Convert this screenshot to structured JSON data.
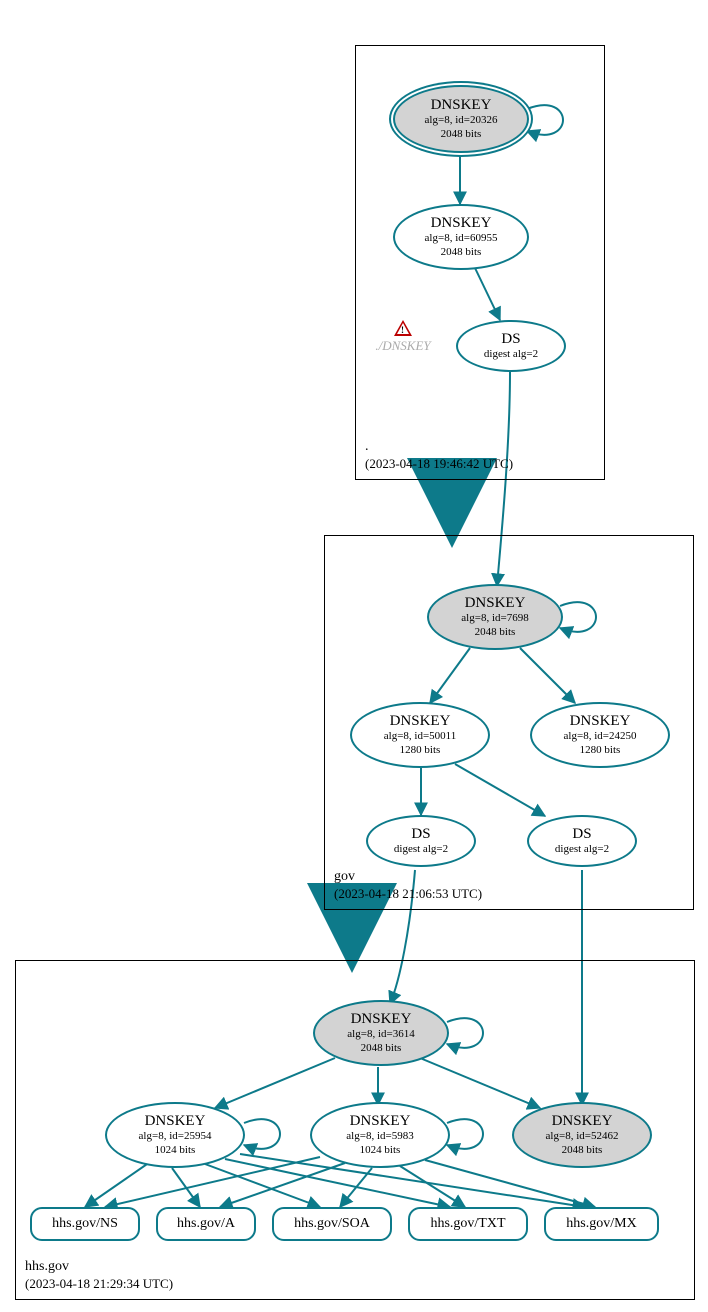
{
  "zones": {
    "root": {
      "name": ".",
      "timestamp": "(2023-04-18 19:46:42 UTC)"
    },
    "gov": {
      "name": "gov",
      "timestamp": "(2023-04-18 21:06:53 UTC)"
    },
    "hhs": {
      "name": "hhs.gov",
      "timestamp": "(2023-04-18 21:29:34 UTC)"
    }
  },
  "nodes": {
    "root_ksk": {
      "title": "DNSKEY",
      "line2": "alg=8, id=20326",
      "line3": "2048 bits"
    },
    "root_zsk": {
      "title": "DNSKEY",
      "line2": "alg=8, id=60955",
      "line3": "2048 bits"
    },
    "root_ds": {
      "title": "DS",
      "line2": "digest alg=2"
    },
    "root_warn": {
      "label": "./DNSKEY"
    },
    "gov_ksk": {
      "title": "DNSKEY",
      "line2": "alg=8, id=7698",
      "line3": "2048 bits"
    },
    "gov_zsk1": {
      "title": "DNSKEY",
      "line2": "alg=8, id=50011",
      "line3": "1280 bits"
    },
    "gov_zsk2": {
      "title": "DNSKEY",
      "line2": "alg=8, id=24250",
      "line3": "1280 bits"
    },
    "gov_ds1": {
      "title": "DS",
      "line2": "digest alg=2"
    },
    "gov_ds2": {
      "title": "DS",
      "line2": "digest alg=2"
    },
    "hhs_ksk": {
      "title": "DNSKEY",
      "line2": "alg=8, id=3614",
      "line3": "2048 bits"
    },
    "hhs_zsk1": {
      "title": "DNSKEY",
      "line2": "alg=8, id=25954",
      "line3": "1024 bits"
    },
    "hhs_zsk2": {
      "title": "DNSKEY",
      "line2": "alg=8, id=5983",
      "line3": "1024 bits"
    },
    "hhs_other": {
      "title": "DNSKEY",
      "line2": "alg=8, id=52462",
      "line3": "2048 bits"
    },
    "rr_ns": {
      "label": "hhs.gov/NS"
    },
    "rr_a": {
      "label": "hhs.gov/A"
    },
    "rr_soa": {
      "label": "hhs.gov/SOA"
    },
    "rr_txt": {
      "label": "hhs.gov/TXT"
    },
    "rr_mx": {
      "label": "hhs.gov/MX"
    }
  },
  "chart_data": {
    "type": "diagram",
    "description": "DNSSEC authentication chain / DNSViz-style graph",
    "zones": [
      {
        "name": ".",
        "timestamp": "2023-04-18 19:46:42 UTC"
      },
      {
        "name": "gov",
        "timestamp": "2023-04-18 21:06:53 UTC"
      },
      {
        "name": "hhs.gov",
        "timestamp": "2023-04-18 21:29:34 UTC"
      }
    ],
    "nodes": [
      {
        "id": "root_ksk",
        "zone": ".",
        "type": "DNSKEY",
        "alg": 8,
        "key_id": 20326,
        "bits": 2048,
        "ksk": true,
        "trust_anchor": true
      },
      {
        "id": "root_zsk",
        "zone": ".",
        "type": "DNSKEY",
        "alg": 8,
        "key_id": 60955,
        "bits": 2048
      },
      {
        "id": "root_ds",
        "zone": ".",
        "type": "DS",
        "digest_alg": 2
      },
      {
        "id": "root_warn",
        "zone": ".",
        "type": "warning",
        "label": "./DNSKEY"
      },
      {
        "id": "gov_ksk",
        "zone": "gov",
        "type": "DNSKEY",
        "alg": 8,
        "key_id": 7698,
        "bits": 2048,
        "ksk": true
      },
      {
        "id": "gov_zsk1",
        "zone": "gov",
        "type": "DNSKEY",
        "alg": 8,
        "key_id": 50011,
        "bits": 1280
      },
      {
        "id": "gov_zsk2",
        "zone": "gov",
        "type": "DNSKEY",
        "alg": 8,
        "key_id": 24250,
        "bits": 1280
      },
      {
        "id": "gov_ds1",
        "zone": "gov",
        "type": "DS",
        "digest_alg": 2
      },
      {
        "id": "gov_ds2",
        "zone": "gov",
        "type": "DS",
        "digest_alg": 2
      },
      {
        "id": "hhs_ksk",
        "zone": "hhs.gov",
        "type": "DNSKEY",
        "alg": 8,
        "key_id": 3614,
        "bits": 2048,
        "ksk": true
      },
      {
        "id": "hhs_zsk1",
        "zone": "hhs.gov",
        "type": "DNSKEY",
        "alg": 8,
        "key_id": 25954,
        "bits": 1024
      },
      {
        "id": "hhs_zsk2",
        "zone": "hhs.gov",
        "type": "DNSKEY",
        "alg": 8,
        "key_id": 5983,
        "bits": 1024
      },
      {
        "id": "hhs_other",
        "zone": "hhs.gov",
        "type": "DNSKEY",
        "alg": 8,
        "key_id": 52462,
        "bits": 2048,
        "ksk": true
      },
      {
        "id": "rr_ns",
        "zone": "hhs.gov",
        "type": "RRset",
        "rrtype": "NS"
      },
      {
        "id": "rr_a",
        "zone": "hhs.gov",
        "type": "RRset",
        "rrtype": "A"
      },
      {
        "id": "rr_soa",
        "zone": "hhs.gov",
        "type": "RRset",
        "rrtype": "SOA"
      },
      {
        "id": "rr_txt",
        "zone": "hhs.gov",
        "type": "RRset",
        "rrtype": "TXT"
      },
      {
        "id": "rr_mx",
        "zone": "hhs.gov",
        "type": "RRset",
        "rrtype": "MX"
      }
    ],
    "edges": [
      {
        "from": "root_ksk",
        "to": "root_ksk",
        "self": true
      },
      {
        "from": "root_ksk",
        "to": "root_zsk"
      },
      {
        "from": "root_zsk",
        "to": "root_ds"
      },
      {
        "from": "root_ds",
        "to": "gov_ksk"
      },
      {
        "from": "gov_ksk",
        "to": "gov_ksk",
        "self": true
      },
      {
        "from": "gov_ksk",
        "to": "gov_zsk1"
      },
      {
        "from": "gov_ksk",
        "to": "gov_zsk2"
      },
      {
        "from": "gov_zsk1",
        "to": "gov_ds1"
      },
      {
        "from": "gov_zsk1",
        "to": "gov_ds2"
      },
      {
        "from": "gov_ds1",
        "to": "hhs_ksk"
      },
      {
        "from": "gov_ds2",
        "to": "hhs_other"
      },
      {
        "from": "hhs_ksk",
        "to": "hhs_ksk",
        "self": true
      },
      {
        "from": "hhs_ksk",
        "to": "hhs_zsk1"
      },
      {
        "from": "hhs_ksk",
        "to": "hhs_zsk2"
      },
      {
        "from": "hhs_ksk",
        "to": "hhs_other"
      },
      {
        "from": "hhs_zsk1",
        "to": "hhs_zsk1",
        "self": true
      },
      {
        "from": "hhs_zsk2",
        "to": "hhs_zsk2",
        "self": true
      },
      {
        "from": "hhs_zsk1",
        "to": "rr_ns"
      },
      {
        "from": "hhs_zsk1",
        "to": "rr_a"
      },
      {
        "from": "hhs_zsk1",
        "to": "rr_soa"
      },
      {
        "from": "hhs_zsk1",
        "to": "rr_txt"
      },
      {
        "from": "hhs_zsk1",
        "to": "rr_mx"
      },
      {
        "from": "hhs_zsk2",
        "to": "rr_ns"
      },
      {
        "from": "hhs_zsk2",
        "to": "rr_a"
      },
      {
        "from": "hhs_zsk2",
        "to": "rr_soa"
      },
      {
        "from": "hhs_zsk2",
        "to": "rr_txt"
      },
      {
        "from": "hhs_zsk2",
        "to": "rr_mx"
      }
    ],
    "delegations": [
      {
        "from_zone": ".",
        "to_zone": "gov",
        "thick": true
      },
      {
        "from_zone": "gov",
        "to_zone": "hhs.gov",
        "thick": true
      }
    ]
  }
}
